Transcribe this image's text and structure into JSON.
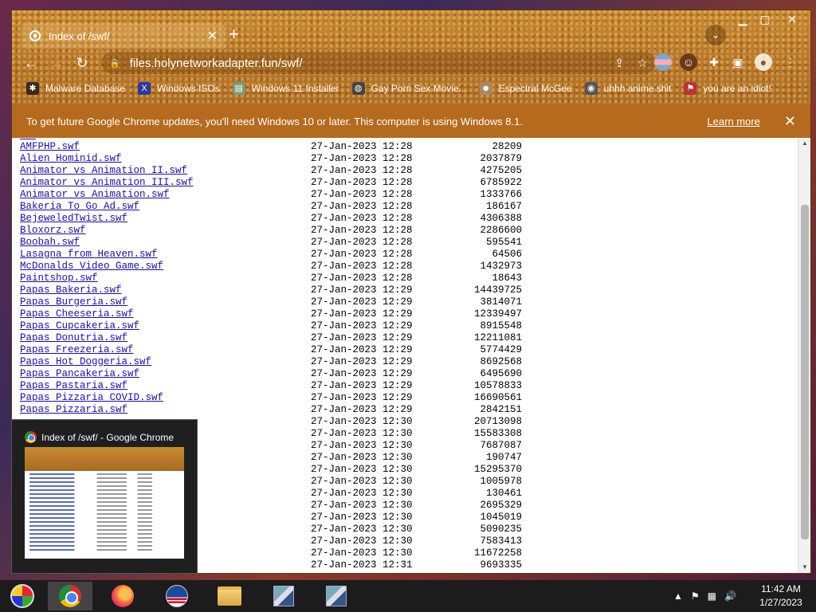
{
  "window": {
    "tab_title": "Index of /swf/",
    "new_tab": "+",
    "close_tab": "✕",
    "url": "files.holynetworkadapter.fun/swf/"
  },
  "bookmarks": [
    {
      "label": "Malware Database",
      "icon": "bug-icon",
      "color": "#3a2a1a"
    },
    {
      "label": "Windows ISOs",
      "icon": "x-icon",
      "color": "#2a3aa0"
    },
    {
      "label": "Windows 11 Installer",
      "icon": "installer-icon",
      "color": "#7a9a7a"
    },
    {
      "label": "Gay Porn Sex Movie...",
      "icon": "globe-icon",
      "color": "#444"
    },
    {
      "label": "Espectral McGee",
      "icon": "face-icon",
      "color": "#a86"
    },
    {
      "label": "uhhh anime shit",
      "icon": "anime-icon",
      "color": "#555"
    },
    {
      "label": "you are an idiot!",
      "icon": "flag-icon",
      "color": "#b33"
    }
  ],
  "infobar": {
    "message": "To get future Google Chrome updates, you'll need Windows 10 or later. This computer is using Windows 8.1.",
    "link": "Learn more"
  },
  "files": [
    {
      "name": "AMFPHP.swf",
      "date": "27-Jan-2023 12:28",
      "size": "28209"
    },
    {
      "name": "Alien Hominid.swf",
      "date": "27-Jan-2023 12:28",
      "size": "2037879"
    },
    {
      "name": "Animator vs Animation II.swf",
      "date": "27-Jan-2023 12:28",
      "size": "4275205"
    },
    {
      "name": "Animator vs Animation III.swf",
      "date": "27-Jan-2023 12:28",
      "size": "6785922"
    },
    {
      "name": "Animator vs Animation.swf",
      "date": "27-Jan-2023 12:28",
      "size": "1333766"
    },
    {
      "name": "Bakeria To Go Ad.swf",
      "date": "27-Jan-2023 12:28",
      "size": "186167"
    },
    {
      "name": "BejeweledTwist.swf",
      "date": "27-Jan-2023 12:28",
      "size": "4306388"
    },
    {
      "name": "Bloxorz.swf",
      "date": "27-Jan-2023 12:28",
      "size": "2286600"
    },
    {
      "name": "Boobah.swf",
      "date": "27-Jan-2023 12:28",
      "size": "595541"
    },
    {
      "name": "Lasagna from Heaven.swf",
      "date": "27-Jan-2023 12:28",
      "size": "64506"
    },
    {
      "name": "McDonalds Video Game.swf",
      "date": "27-Jan-2023 12:28",
      "size": "1432973"
    },
    {
      "name": "Paintshop.swf",
      "date": "27-Jan-2023 12:28",
      "size": "18643"
    },
    {
      "name": "Papas Bakeria.swf",
      "date": "27-Jan-2023 12:29",
      "size": "14439725"
    },
    {
      "name": "Papas Burgeria.swf",
      "date": "27-Jan-2023 12:29",
      "size": "3814071"
    },
    {
      "name": "Papas Cheeseria.swf",
      "date": "27-Jan-2023 12:29",
      "size": "12339497"
    },
    {
      "name": "Papas Cupcakeria.swf",
      "date": "27-Jan-2023 12:29",
      "size": "8915548"
    },
    {
      "name": "Papas Donutria.swf",
      "date": "27-Jan-2023 12:29",
      "size": "12211081"
    },
    {
      "name": "Papas Freezeria.swf",
      "date": "27-Jan-2023 12:29",
      "size": "5774429"
    },
    {
      "name": "Papas Hot Doggeria.swf",
      "date": "27-Jan-2023 12:29",
      "size": "8692568"
    },
    {
      "name": "Papas Pancakeria.swf",
      "date": "27-Jan-2023 12:29",
      "size": "6495690"
    },
    {
      "name": "Papas Pastaria.swf",
      "date": "27-Jan-2023 12:29",
      "size": "10578833"
    },
    {
      "name": "Papas Pizzaria COVID.swf",
      "date": "27-Jan-2023 12:29",
      "size": "16690561"
    },
    {
      "name": "Papas Pizzaria.swf",
      "date": "27-Jan-2023 12:29",
      "size": "2842151"
    },
    {
      "name": "",
      "date": "27-Jan-2023 12:30",
      "size": "20713098"
    },
    {
      "name": "",
      "date": "27-Jan-2023 12:30",
      "size": "15583308"
    },
    {
      "name": "",
      "date": "27-Jan-2023 12:30",
      "size": "7687087"
    },
    {
      "name": "",
      "date": "27-Jan-2023 12:30",
      "size": "190747"
    },
    {
      "name": "",
      "date": "27-Jan-2023 12:30",
      "size": "15295370"
    },
    {
      "name": "",
      "date": "27-Jan-2023 12:30",
      "size": "1005978"
    },
    {
      "name": "",
      "date": "27-Jan-2023 12:30",
      "size": "130461"
    },
    {
      "name": "",
      "date": "27-Jan-2023 12:30",
      "size": "2695329"
    },
    {
      "name": "",
      "date": "27-Jan-2023 12:30",
      "size": "1045019"
    },
    {
      "name": "",
      "date": "27-Jan-2023 12:30",
      "size": "5090235"
    },
    {
      "name": "",
      "date": "27-Jan-2023 12:30",
      "size": "7583413"
    },
    {
      "name": "",
      "date": "27-Jan-2023 12:30",
      "size": "11672258"
    },
    {
      "name": "",
      "date": "27-Jan-2023 12:31",
      "size": "9693335"
    }
  ],
  "preview": {
    "title": "Index of /swf/ - Google Chrome"
  },
  "taskbar": {
    "apps": [
      "start-icon",
      "chrome-icon",
      "firefox-icon",
      "obama-icon",
      "explorer-icon",
      "installer-icon",
      "installer-icon"
    ]
  },
  "clock": {
    "time": "11:42 AM",
    "date": "1/27/2023"
  }
}
